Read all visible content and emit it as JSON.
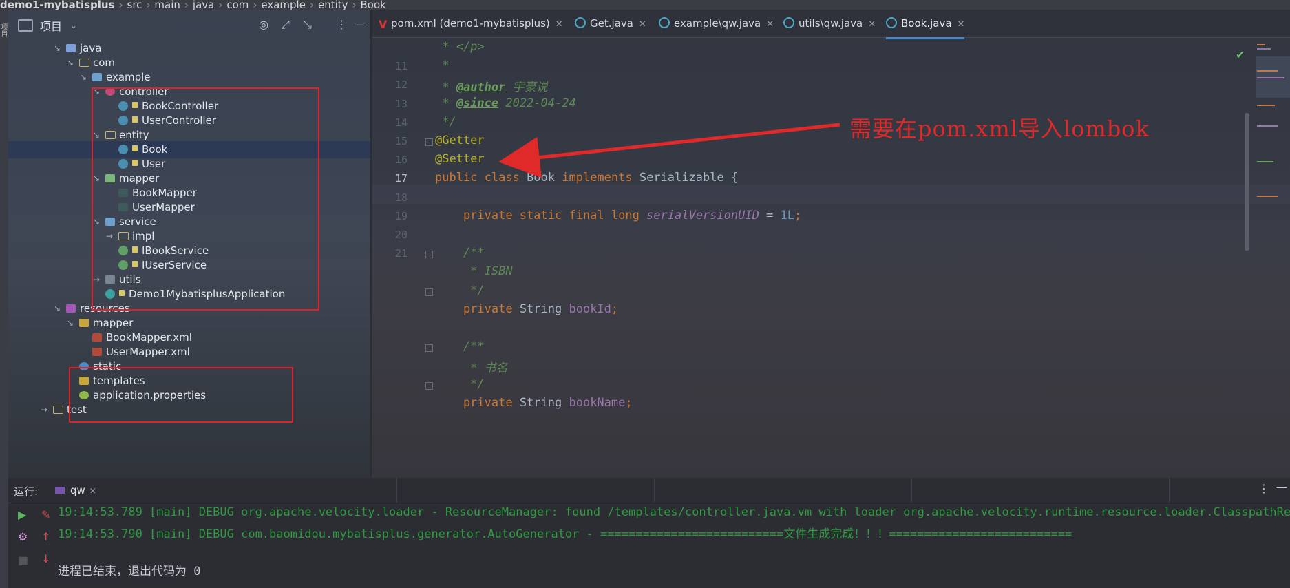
{
  "breadcrumb": [
    "demo1-mybatisplus",
    "src",
    "main",
    "java",
    "com",
    "example",
    "entity",
    "Book"
  ],
  "left_strip": {
    "label": "项目"
  },
  "project_panel": {
    "title": "项目",
    "tree": [
      {
        "label": "java",
        "icon": "folder-blue",
        "arrow": "↘",
        "depth": 0,
        "top": 0
      },
      {
        "label": "com",
        "icon": "folder",
        "arrow": "↘",
        "depth": 1
      },
      {
        "label": "example",
        "icon": "pkg",
        "arrow": "↘",
        "depth": 2
      },
      {
        "label": "controller",
        "icon": "pkg-ctrl",
        "arrow": "↘",
        "depth": 3
      },
      {
        "label": "BookController",
        "icon": "class",
        "lock": true,
        "depth": 4
      },
      {
        "label": "UserController",
        "icon": "class",
        "lock": true,
        "depth": 4
      },
      {
        "label": "entity",
        "icon": "folder",
        "arrow": "↘",
        "depth": 3
      },
      {
        "label": "Book",
        "icon": "class",
        "lock": true,
        "depth": 4,
        "selected": true
      },
      {
        "label": "User",
        "icon": "class",
        "lock": true,
        "depth": 4
      },
      {
        "label": "mapper",
        "icon": "mapper",
        "arrow": "↘",
        "depth": 3
      },
      {
        "label": "BookMapper",
        "icon": "mapper-file",
        "depth": 4
      },
      {
        "label": "UserMapper",
        "icon": "mapper-file",
        "depth": 4
      },
      {
        "label": "service",
        "icon": "pkg",
        "arrow": "↘",
        "depth": 3
      },
      {
        "label": "impl",
        "icon": "folder",
        "arrow": "→",
        "depth": 4
      },
      {
        "label": "IBookService",
        "icon": "iface",
        "lock": true,
        "depth": 4
      },
      {
        "label": "IUserService",
        "icon": "iface",
        "lock": true,
        "depth": 4
      },
      {
        "label": "utils",
        "icon": "utils",
        "arrow": "→",
        "depth": 3
      },
      {
        "label": "Demo1MybatisplusApplication",
        "icon": "app",
        "lock": true,
        "depth": 3
      },
      {
        "label": "resources",
        "icon": "res",
        "arrow": "↘",
        "depth": 0
      },
      {
        "label": "mapper",
        "icon": "res-folder",
        "arrow": "↘",
        "depth": 1
      },
      {
        "label": "BookMapper.xml",
        "icon": "xml",
        "depth": 2
      },
      {
        "label": "UserMapper.xml",
        "icon": "xml",
        "depth": 2
      },
      {
        "label": "static",
        "icon": "static",
        "depth": 1
      },
      {
        "label": "templates",
        "icon": "res-folder",
        "depth": 1
      },
      {
        "label": "application.properties",
        "icon": "props",
        "depth": 1
      },
      {
        "label": "test",
        "icon": "folder",
        "arrow": "→",
        "depth": -1
      }
    ]
  },
  "editor": {
    "tabs": [
      {
        "label": "pom.xml (demo1-mybatisplus)",
        "icon": "maven-icon",
        "active": false
      },
      {
        "label": "Get.java",
        "icon": "class-icon",
        "active": false
      },
      {
        "label": "example\\qw.java",
        "icon": "class-icon",
        "active": false
      },
      {
        "label": "utils\\qw.java",
        "icon": "class-icon",
        "active": false
      },
      {
        "label": "Book.java",
        "icon": "class-icon",
        "active": true
      }
    ],
    "lines": [
      {
        "num": "",
        "html_parts": [
          [
            "cmt",
            " * </p>"
          ]
        ]
      },
      {
        "num": "11",
        "html_parts": [
          [
            "cmt",
            " *"
          ]
        ]
      },
      {
        "num": "12",
        "html_parts": [
          [
            "cmt",
            " * "
          ],
          [
            "doc-tag",
            "@author"
          ],
          [
            "cmt",
            " 宇豪说"
          ]
        ]
      },
      {
        "num": "13",
        "html_parts": [
          [
            "cmt",
            " * "
          ],
          [
            "doc-tag",
            "@since"
          ],
          [
            "cmt",
            " 2022-04-24"
          ]
        ]
      },
      {
        "num": "14",
        "html_parts": [
          [
            "cmt",
            " */"
          ]
        ]
      },
      {
        "num": "15",
        "html_parts": [
          [
            "ann",
            "@Getter"
          ]
        ]
      },
      {
        "num": "16",
        "html_parts": [
          [
            "ann",
            "@Setter"
          ]
        ]
      },
      {
        "num": "17",
        "html_parts": [
          [
            "kw",
            "public class "
          ],
          [
            "cls",
            "Book "
          ],
          [
            "kw",
            "implements "
          ],
          [
            "cls",
            "Serializable {"
          ]
        ],
        "current": true
      },
      {
        "num": "18",
        "html_parts": []
      },
      {
        "num": "19",
        "html_parts": [
          [
            "kw",
            "    private static final long "
          ],
          [
            "field-i",
            "serialVersionUID"
          ],
          [
            "op",
            " = "
          ],
          [
            "num",
            "1L"
          ],
          [
            "kw",
            ";"
          ]
        ]
      },
      {
        "num": "20",
        "html_parts": []
      },
      {
        "num": "21",
        "html_parts": [
          [
            "cmt",
            "    /**"
          ]
        ]
      },
      {
        "num": "",
        "html_parts": [
          [
            "cmt",
            "     * ISBN"
          ]
        ]
      },
      {
        "num": "",
        "html_parts": [
          [
            "cmt",
            "     */"
          ]
        ]
      },
      {
        "num": "",
        "html_parts": [
          [
            "kw",
            "    private "
          ],
          [
            "cls",
            "String "
          ],
          [
            "field",
            "bookId"
          ],
          [
            "kw",
            ";"
          ]
        ]
      },
      {
        "num": "",
        "html_parts": []
      },
      {
        "num": "",
        "html_parts": [
          [
            "cmt",
            "    /**"
          ]
        ]
      },
      {
        "num": "",
        "html_parts": [
          [
            "cmt",
            "     * 书名"
          ]
        ]
      },
      {
        "num": "",
        "html_parts": [
          [
            "cmt",
            "     */"
          ]
        ]
      },
      {
        "num": "",
        "html_parts": [
          [
            "kw",
            "    private "
          ],
          [
            "cls",
            "String "
          ],
          [
            "field",
            "bookName"
          ],
          [
            "kw",
            ";"
          ]
        ]
      }
    ],
    "annotation_text": "需要在pom.xml导入lombok"
  },
  "run_panel": {
    "title": "运行:",
    "tab_label": "qw",
    "console": [
      {
        "type": "log",
        "text": "19:14:53.789 [main] DEBUG org.apache.velocity.loader - ResourceManager: found /templates/controller.java.vm with loader org.apache.velocity.runtime.resource.loader.ClasspathResourceLoader"
      },
      {
        "type": "log",
        "text": "19:14:53.790 [main] DEBUG com.baomidou.mybatisplus.generator.AutoGenerator - ==========================文件生成完成！！！=========================="
      },
      {
        "type": "blank",
        "text": ""
      },
      {
        "type": "exit",
        "text": "进程已结束，退出代码为 0"
      }
    ]
  }
}
